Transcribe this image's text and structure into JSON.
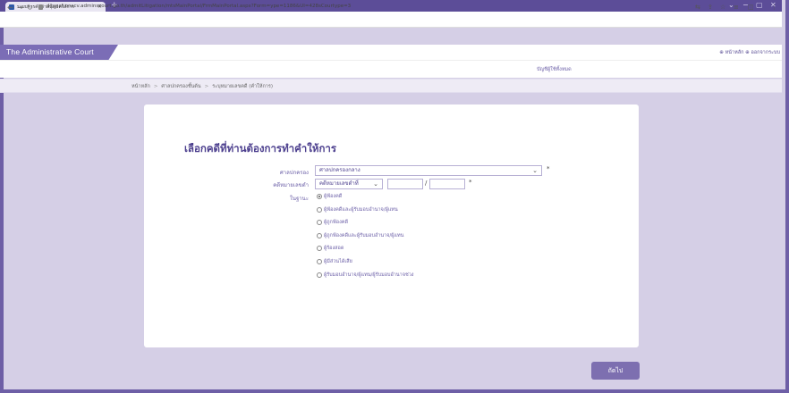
{
  "browser": {
    "tab_title": "ระบบการคัดค่าอนุญาตให้การ",
    "new_tab": "+",
    "url": "ditsgat.onscv.adminscourt.go.th/admitLitigation/mtsMainPortal/FrmMainPortal.aspx?Form=ype=1186&UI=428sCourtype=3",
    "win_min": "−",
    "win_max": "▢",
    "win_close": "✕",
    "win_collapse": "⌄"
  },
  "header": {
    "logo_text": "The Administrative Court",
    "top_links": "⊕ หน้าหลัก ⊕ ออกจากระบบ",
    "user_title": "บัญชีผู้ใช้ทั้งหมด"
  },
  "breadcrumb": {
    "items": [
      "หน้าหลัก",
      "ศาลปกครองชั้นต้น",
      "ระบุหมายเลขคดี (คำให้การ)"
    ],
    "sep": ">"
  },
  "form": {
    "title": "เลือกคดีที่ท่านต้องการทำคำให้การ",
    "court_label": "ศาลปกครอง",
    "court_value": "ศาลปกครองกลาง",
    "case_label": "คดีหมายเลขดำ",
    "case_type_value": "คดีหมายเลขดำที่",
    "case_slash": "/",
    "status_label": "ในฐานะ",
    "required_mark": "*",
    "status_options": [
      "ผู้ฟ้องคดี",
      "ผู้ฟ้องคดีและผู้รับมอบอำนาจ/ผู้แทน",
      "ผู้ถูกฟ้องคดี",
      "ผู้ถูกฟ้องคดีและผู้รับมอบอำนาจ/ผู้แทน",
      "ผู้ร้องสอด",
      "ผู้มีส่วนได้เสีย",
      "ผู้รับมอบอำนาจ/ผู้แทน/ผู้รับมอบอำนาจช่วง"
    ],
    "selected_status_index": 0,
    "next_label": "ถัดไป"
  },
  "colors": {
    "accent": "#7d6fb0",
    "title": "#4c3f8e",
    "page_bg": "#d5cfe6"
  }
}
